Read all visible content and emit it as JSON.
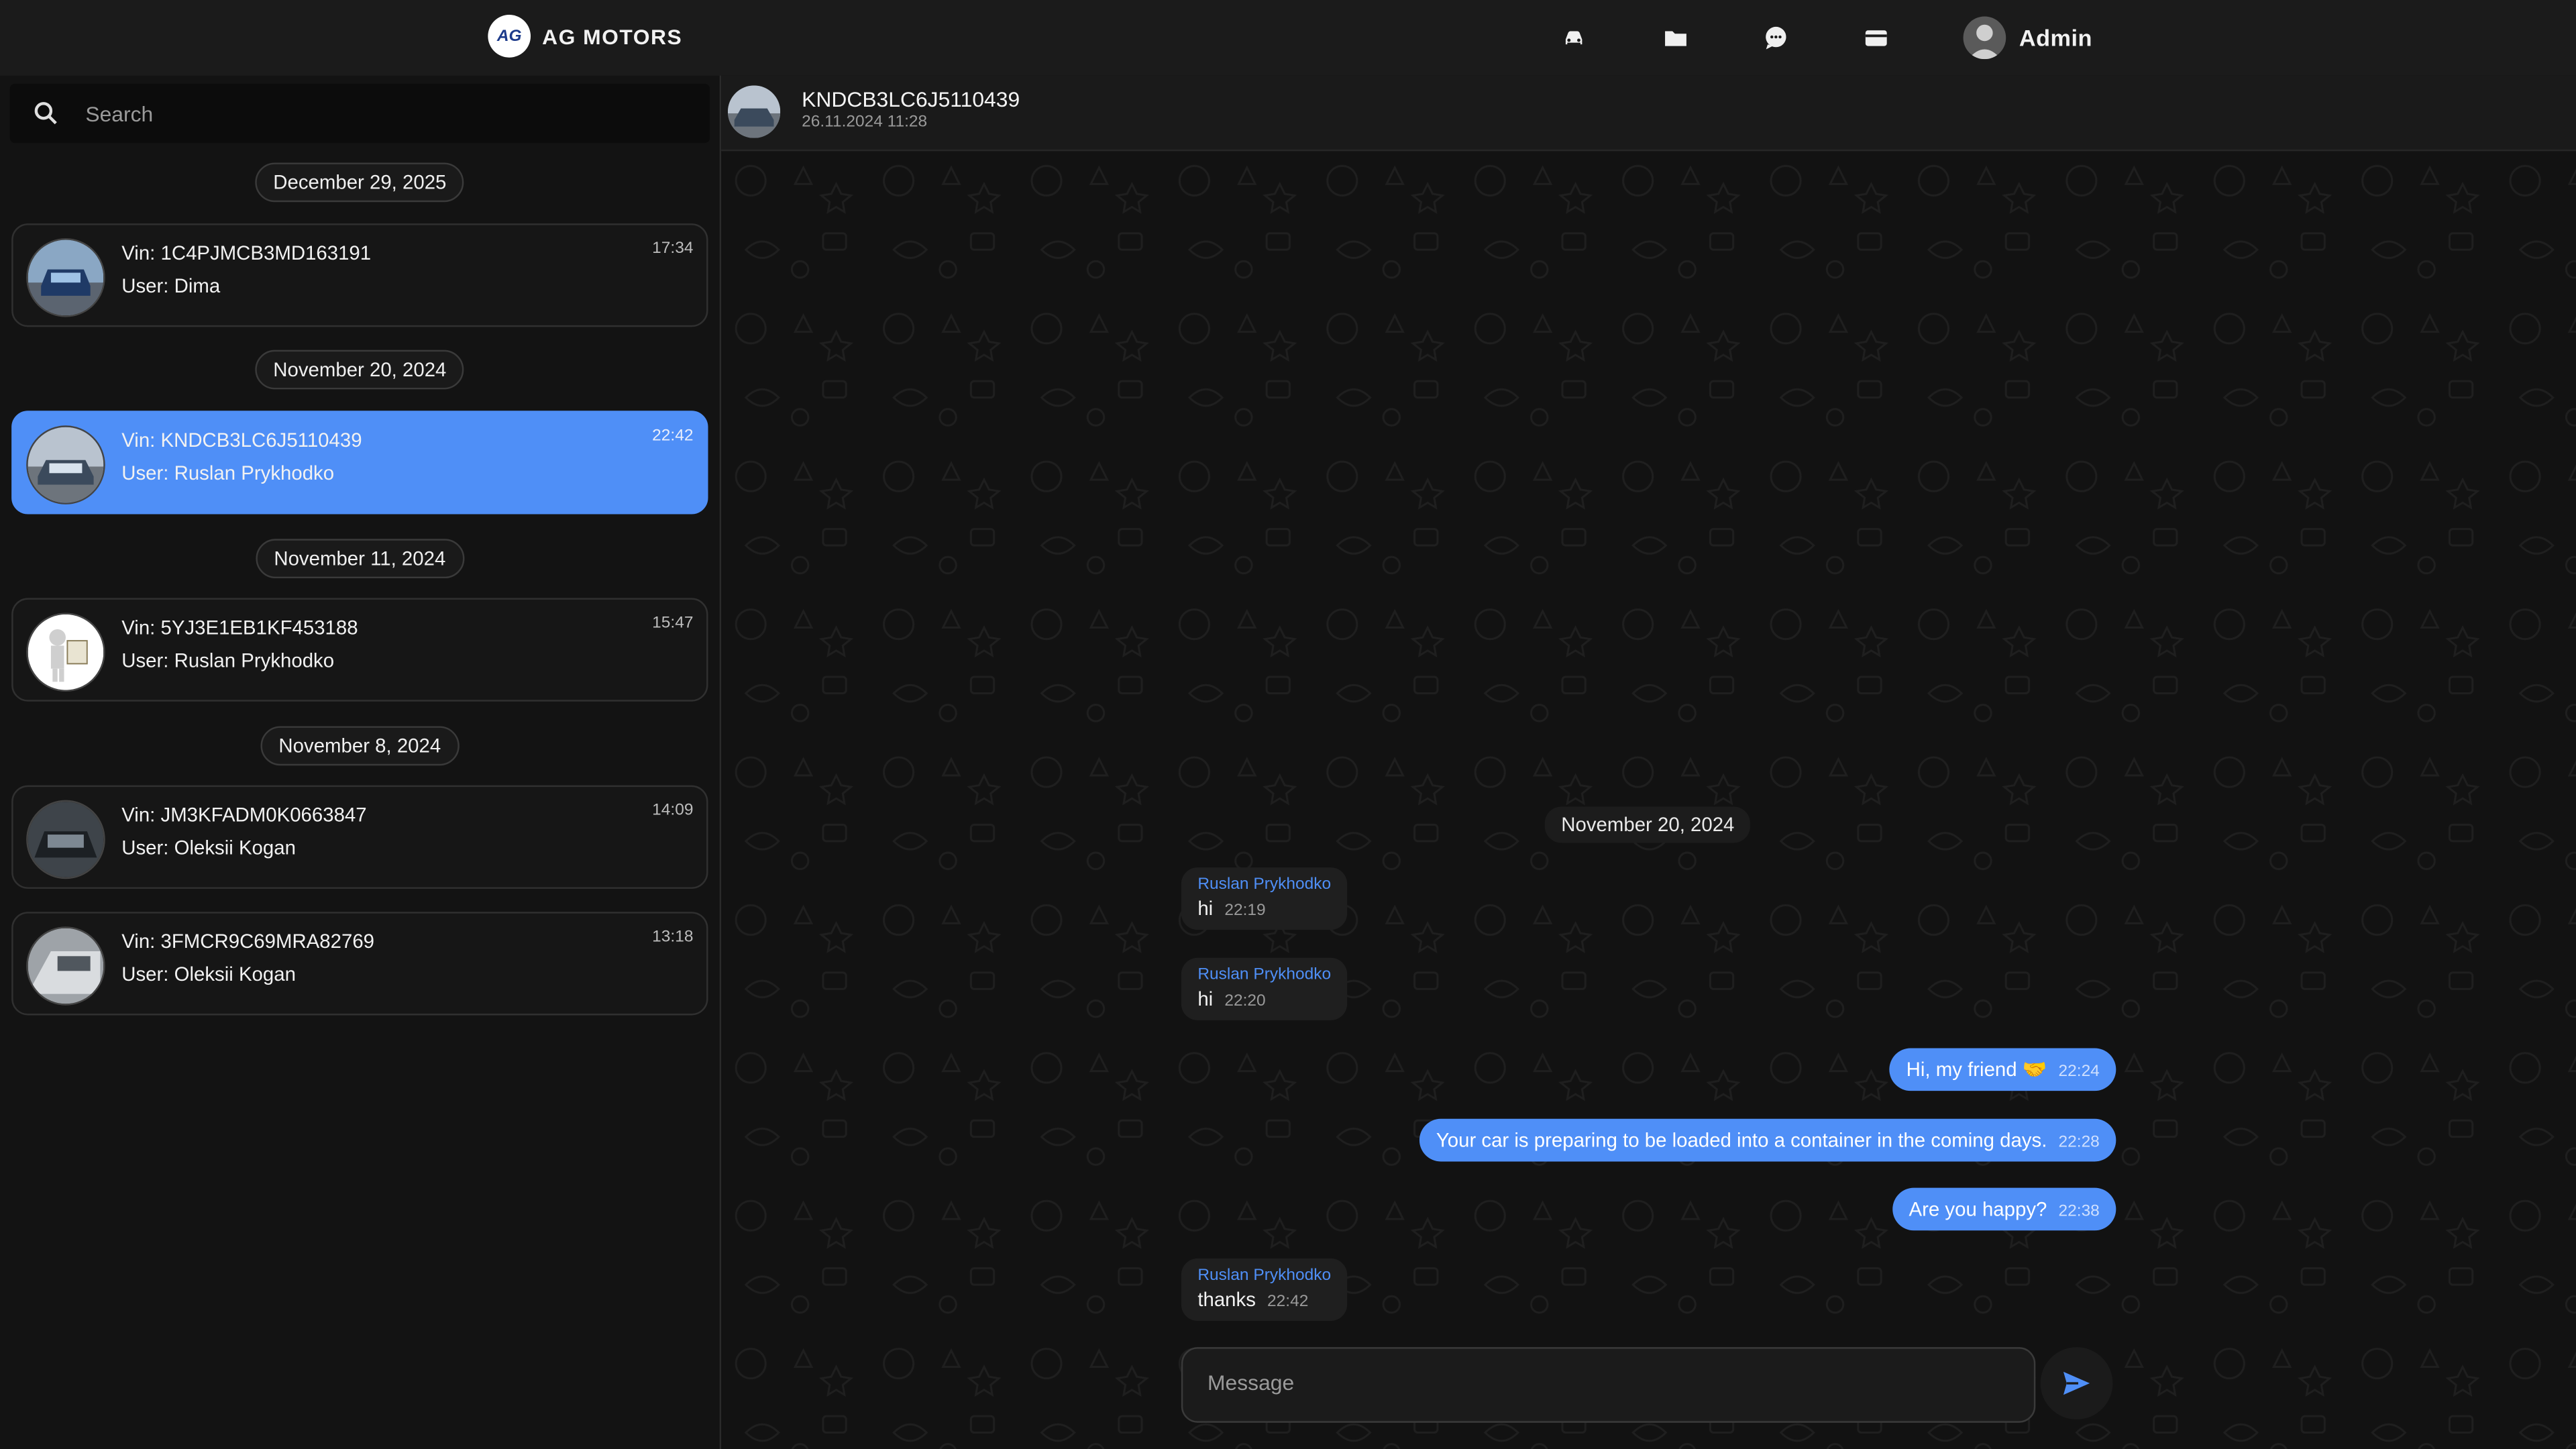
{
  "header": {
    "brand_logo_text": "AG",
    "brand_name": "AG MOTORS",
    "nav_icons": [
      "car-icon",
      "folder-icon",
      "chat-bubble-icon",
      "wallet-icon"
    ],
    "user_name": "Admin"
  },
  "sidebar": {
    "search_placeholder": "Search",
    "groups": [
      {
        "date": "December 29, 2025"
      },
      {
        "date": "November 20, 2024"
      },
      {
        "date": "November 11, 2024"
      },
      {
        "date": "November 8, 2024"
      }
    ],
    "chats": [
      {
        "vin": "Vin: 1C4PJMCB3MD163191",
        "user": "User: Dima",
        "time": "17:34",
        "active": false
      },
      {
        "vin": "Vin: KNDCB3LC6J5110439",
        "user": "User: Ruslan Prykhodko",
        "time": "22:42",
        "active": true
      },
      {
        "vin": "Vin: 5YJ3E1EB1KF453188",
        "user": "User: Ruslan Prykhodko",
        "time": "15:47",
        "active": false
      },
      {
        "vin": "Vin: JM3KFADM0K0663847",
        "user": "User: Oleksii Kogan",
        "time": "14:09",
        "active": false
      },
      {
        "vin": "Vin: 3FMCR9C69MRA82769",
        "user": "User: Oleksii Kogan",
        "time": "13:18",
        "active": false
      }
    ]
  },
  "conversation": {
    "title": "KNDCB3LC6J5110439",
    "subtitle": "26.11.2024 11:28",
    "date_divider": "November 20, 2024",
    "messages": [
      {
        "direction": "in",
        "author": "Ruslan Prykhodko",
        "text": "hi",
        "time": "22:19"
      },
      {
        "direction": "in",
        "author": "Ruslan Prykhodko",
        "text": "hi",
        "time": "22:20"
      },
      {
        "direction": "out",
        "text": "Hi, my friend 🤝",
        "time": "22:24"
      },
      {
        "direction": "out",
        "text": "Your car is preparing to be loaded into a container in the coming days.",
        "time": "22:28"
      },
      {
        "direction": "out",
        "text": "Are you happy?",
        "time": "22:38"
      },
      {
        "direction": "in",
        "author": "Ruslan Prykhodko",
        "text": "thanks",
        "time": "22:42"
      }
    ],
    "composer_placeholder": "Message"
  },
  "colors": {
    "accent": "#4f8ff7",
    "background": "#131313",
    "bubble_in": "#1f1f1f"
  }
}
